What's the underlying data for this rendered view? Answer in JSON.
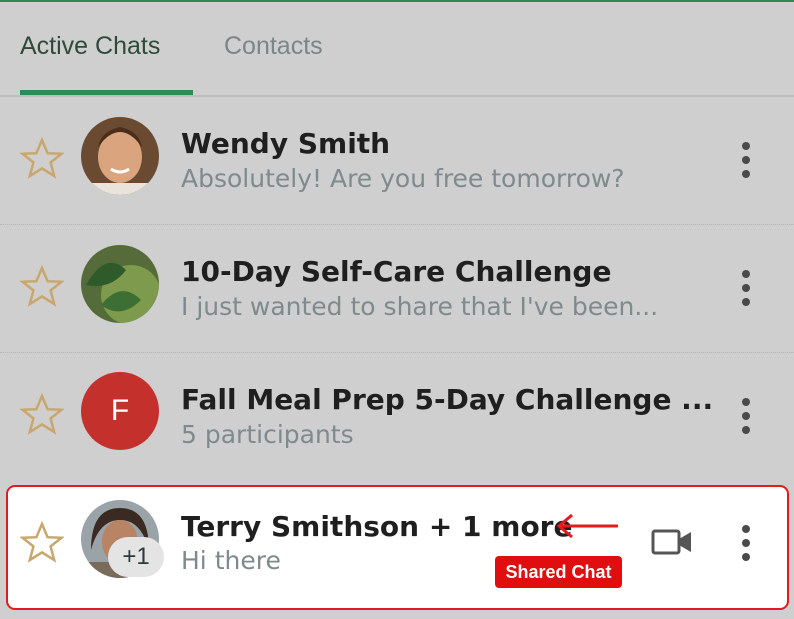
{
  "tabs": [
    {
      "label": "Active Chats",
      "active": true
    },
    {
      "label": "Contacts",
      "active": false
    }
  ],
  "chats": [
    {
      "name": "Wendy Smith",
      "preview": "Absolutely! Are you free tomorrow?",
      "avatar": "photo-woman-icon",
      "starred": false
    },
    {
      "name": "10-Day Self-Care Challenge",
      "preview": "I just wanted to share that I've been...",
      "avatar": "photo-greens-icon",
      "starred": false
    },
    {
      "name": "Fall Meal Prep 5-Day Challenge ...",
      "preview": "5 participants",
      "avatar_letter": "F",
      "starred": false
    },
    {
      "name": "Terry Smithson + 1 more",
      "preview": "Hi there",
      "avatar": "photo-woman-icon",
      "extra_badge": "+1",
      "starred": false
    }
  ],
  "annotation": {
    "label": "Shared Chat",
    "color": "#e00e0e"
  },
  "colors": {
    "accent": "#2e8b57",
    "highlight_border": "#e31b1b",
    "star": "#c9a66b"
  }
}
